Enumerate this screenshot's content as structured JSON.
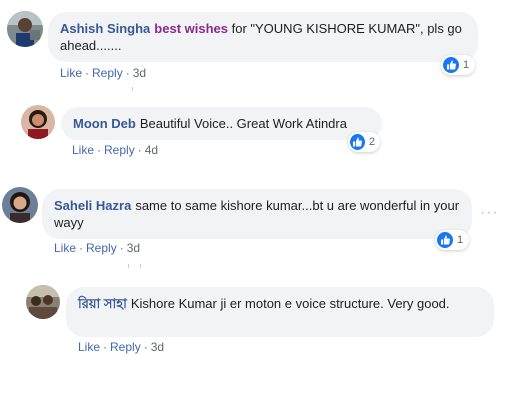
{
  "comments": [
    {
      "author": "Ashish Singha",
      "highlight": "best wishes",
      "text": " for \"YOUNG KISHORE KUMAR\", pls go ahead.......",
      "like": "Like",
      "reply": "Reply",
      "time": "3d",
      "reaction_count": "1"
    },
    {
      "author": "Moon Deb",
      "text": "Beautiful Voice.. Great Work Atindra",
      "like": "Like",
      "reply": "Reply",
      "time": "4d",
      "reaction_count": "2"
    },
    {
      "author": "Saheli Hazra",
      "text": "same to same kishore kumar...bt u are wonderful in your wayy",
      "like": "Like",
      "reply": "Reply",
      "time": "3d",
      "reaction_count": "1",
      "more": "···"
    },
    {
      "author": "রিয়া সাহা",
      "text": "Kishore Kumar ji er moton e voice structure. Very good.",
      "like": "Like",
      "reply": "Reply",
      "time": "3d"
    }
  ],
  "separator": "·",
  "icons": {
    "reaction": "like-thumb-icon",
    "more": "more-options-icon"
  },
  "colors": {
    "author": "#385898",
    "highlight": "#8b2a8e",
    "action": "#4267b2",
    "bubble": "#f2f3f5",
    "like_badge": "#1877f2"
  }
}
